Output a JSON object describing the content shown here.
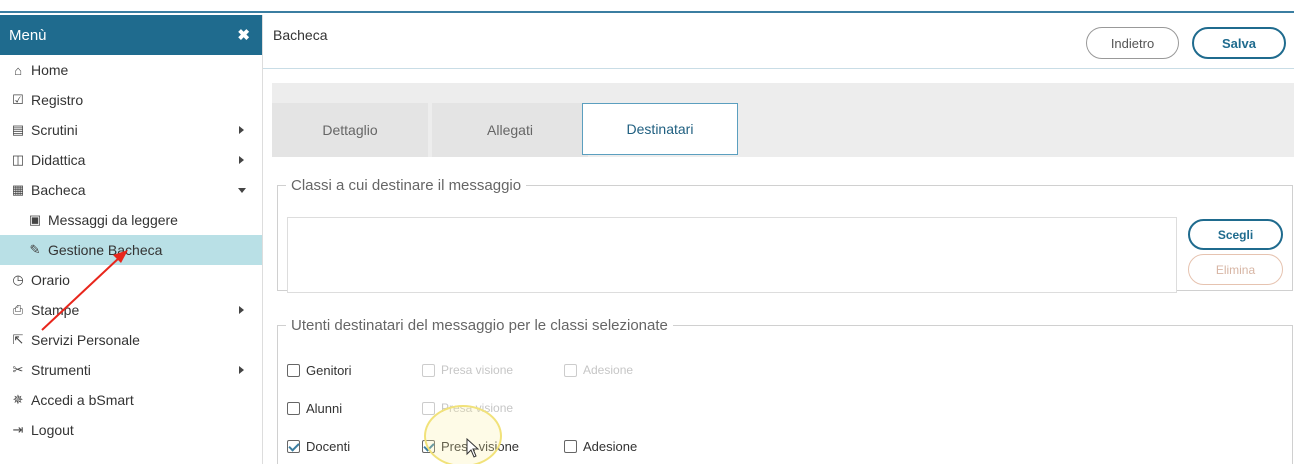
{
  "sidebar": {
    "title": "Menù",
    "items": [
      {
        "label": "Home"
      },
      {
        "label": "Registro"
      },
      {
        "label": "Scrutini"
      },
      {
        "label": "Didattica"
      },
      {
        "label": "Bacheca"
      },
      {
        "label": "Messaggi da leggere"
      },
      {
        "label": "Gestione Bacheca"
      },
      {
        "label": "Orario"
      },
      {
        "label": "Stampe"
      },
      {
        "label": "Servizi Personale"
      },
      {
        "label": "Strumenti"
      },
      {
        "label": "Accedi a bSmart"
      },
      {
        "label": "Logout"
      }
    ]
  },
  "header": {
    "title": "Bacheca",
    "back_label": "Indietro",
    "save_label": "Salva"
  },
  "tabs": [
    "Dettaglio",
    "Allegati",
    "Destinatari"
  ],
  "classes_section": {
    "legend": "Classi a cui destinare il messaggio",
    "choose_label": "Scegli",
    "delete_label": "Elimina"
  },
  "users_section": {
    "legend": "Utenti destinatari del messaggio per le classi selezionate",
    "rows": [
      {
        "label": "Genitori",
        "presa": "Presa visione",
        "adesione": "Adesione"
      },
      {
        "label": "Alunni",
        "presa": "Presa visione"
      },
      {
        "label": "Docenti",
        "presa": "Presa visione",
        "adesione": "Adesione"
      }
    ]
  },
  "colors": {
    "accent": "#1f6b8e",
    "active_item": "#b9e0e6",
    "annotation": "#e8261c"
  }
}
